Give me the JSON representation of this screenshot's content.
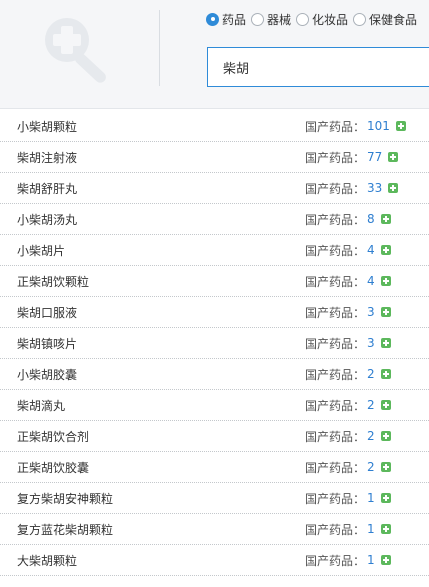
{
  "categories": [
    {
      "label": "药品",
      "checked": true
    },
    {
      "label": "器械",
      "checked": false
    },
    {
      "label": "化妆品",
      "checked": false
    },
    {
      "label": "保健食品",
      "checked": false
    }
  ],
  "search": {
    "value": "柴胡"
  },
  "results": [
    {
      "name": "小柴胡颗粒",
      "label": "国产药品：",
      "count": "101"
    },
    {
      "name": "柴胡注射液",
      "label": "国产药品：",
      "count": "77"
    },
    {
      "name": "柴胡舒肝丸",
      "label": "国产药品：",
      "count": "33"
    },
    {
      "name": "小柴胡汤丸",
      "label": "国产药品：",
      "count": "8"
    },
    {
      "name": "小柴胡片",
      "label": "国产药品：",
      "count": "4"
    },
    {
      "name": "正柴胡饮颗粒",
      "label": "国产药品：",
      "count": "4"
    },
    {
      "name": "柴胡口服液",
      "label": "国产药品：",
      "count": "3"
    },
    {
      "name": "柴胡镇咳片",
      "label": "国产药品：",
      "count": "3"
    },
    {
      "name": "小柴胡胶囊",
      "label": "国产药品：",
      "count": "2"
    },
    {
      "name": "柴胡滴丸",
      "label": "国产药品：",
      "count": "2"
    },
    {
      "name": "正柴胡饮合剂",
      "label": "国产药品：",
      "count": "2"
    },
    {
      "name": "正柴胡饮胶囊",
      "label": "国产药品：",
      "count": "2"
    },
    {
      "name": "复方柴胡安神颗粒",
      "label": "国产药品：",
      "count": "1"
    },
    {
      "name": "复方蓝花柴胡颗粒",
      "label": "国产药品：",
      "count": "1"
    },
    {
      "name": "大柴胡颗粒",
      "label": "国产药品：",
      "count": "1"
    }
  ],
  "icons": {
    "logo": "magnifier-plus-icon",
    "add": "plus-icon",
    "radio": "radio-icon"
  },
  "colors": {
    "accent": "#2f8bd8",
    "count": "#2f7fd0",
    "add_button": "#5cb85c",
    "header_bg": "#f5f6f8"
  }
}
